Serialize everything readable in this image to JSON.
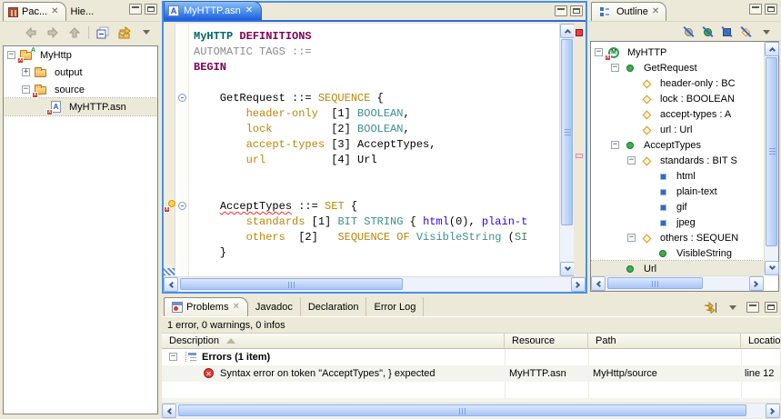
{
  "icons": {
    "close_glyph": "✕",
    "collapse_glyph": "−",
    "expand_glyph": "+",
    "asn_letter": "A",
    "module_letter": "M",
    "badge_letter": "x",
    "project_deco": "A"
  },
  "colors": {
    "chrome_bg": "#ece9d8",
    "active_tab_blue": "#1a5edb",
    "editor_border_blue": "#4791e6",
    "error_red": "#dd3b35",
    "keyword_purple": "#7f0055",
    "module_teal": "#006666",
    "type_teal": "#3a8f8f",
    "field_gold": "#b8860b",
    "string_blue": "#2a00ff",
    "selection_beige": "#ebe9d9"
  },
  "package_explorer": {
    "tab_active": "Pac...",
    "tab_inactive": "Hie...",
    "toolbar_icons": [
      "back-icon",
      "forward-icon",
      "up-icon",
      "collapse-all-icon",
      "link-with-editor-icon",
      "view-menu-icon"
    ],
    "tree": [
      {
        "label": "MyHttp",
        "icon": "project-error",
        "indent": 0,
        "expander": "minus"
      },
      {
        "label": "output",
        "icon": "folder",
        "indent": 1,
        "expander": "plus"
      },
      {
        "label": "source",
        "icon": "folder-error",
        "indent": 1,
        "expander": "minus"
      },
      {
        "label": "MyHTTP.asn",
        "icon": "asn-file-error",
        "indent": 2,
        "expander": "none",
        "selected": true
      }
    ]
  },
  "editor": {
    "tab_label": "MyHTTP.asn",
    "code_lines": [
      [
        {
          "t": "MyHTTP",
          "c": "mod"
        },
        {
          "t": " ",
          "c": "plain"
        },
        {
          "t": "DEFINITIONS",
          "c": "kw"
        }
      ],
      [
        {
          "t": "AUTOMATIC TAGS ::=",
          "c": "gray"
        }
      ],
      [
        {
          "t": "BEGIN",
          "c": "kw"
        }
      ],
      [],
      [
        {
          "t": "    GetRequest ::= ",
          "c": "plain"
        },
        {
          "t": "SEQUENCE",
          "c": "gold"
        },
        {
          "t": " {",
          "c": "plain"
        }
      ],
      [
        {
          "t": "        ",
          "c": "plain"
        },
        {
          "t": "header-only",
          "c": "gold"
        },
        {
          "t": "  [1] ",
          "c": "plain"
        },
        {
          "t": "BOOLEAN",
          "c": "type"
        },
        {
          "t": ",",
          "c": "plain"
        }
      ],
      [
        {
          "t": "        ",
          "c": "plain"
        },
        {
          "t": "lock",
          "c": "gold"
        },
        {
          "t": "         [2] ",
          "c": "plain"
        },
        {
          "t": "BOOLEAN",
          "c": "type"
        },
        {
          "t": ",",
          "c": "plain"
        }
      ],
      [
        {
          "t": "        ",
          "c": "plain"
        },
        {
          "t": "accept-types",
          "c": "gold"
        },
        {
          "t": " [3] AcceptTypes,",
          "c": "plain"
        }
      ],
      [
        {
          "t": "        ",
          "c": "plain"
        },
        {
          "t": "url",
          "c": "gold"
        },
        {
          "t": "          [4] Url",
          "c": "plain"
        }
      ],
      [],
      [],
      [
        {
          "t": "    ",
          "c": "plain"
        },
        {
          "t": "AcceptTypes",
          "c": "err"
        },
        {
          "t": " ::= ",
          "c": "plain"
        },
        {
          "t": "SET",
          "c": "gold"
        },
        {
          "t": " {",
          "c": "plain"
        }
      ],
      [
        {
          "t": "        ",
          "c": "plain"
        },
        {
          "t": "standards",
          "c": "gold"
        },
        {
          "t": " [1] ",
          "c": "plain"
        },
        {
          "t": "BIT STRING",
          "c": "type"
        },
        {
          "t": " { ",
          "c": "plain"
        },
        {
          "t": "html",
          "c": "str"
        },
        {
          "t": "(0), ",
          "c": "plain"
        },
        {
          "t": "plain-t",
          "c": "str"
        }
      ],
      [
        {
          "t": "        ",
          "c": "plain"
        },
        {
          "t": "others",
          "c": "gold"
        },
        {
          "t": "  [2]   ",
          "c": "plain"
        },
        {
          "t": "SEQUENCE OF",
          "c": "gold"
        },
        {
          "t": " ",
          "c": "plain"
        },
        {
          "t": "VisibleString",
          "c": "type"
        },
        {
          "t": " (",
          "c": "plain"
        },
        {
          "t": "SI",
          "c": "grn"
        }
      ],
      [
        {
          "t": "    }",
          "c": "plain"
        }
      ]
    ]
  },
  "outline": {
    "tab_label": "Outline",
    "toolbar_icons": [
      "filter-circle-gray-icon",
      "filter-circle-green-icon",
      "filter-square-blue-icon",
      "filter-diamond-gold-icon",
      "view-menu-icon"
    ],
    "tree": [
      {
        "label": "MyHTTP",
        "icon": "module-error",
        "indent": 0,
        "expander": "minus"
      },
      {
        "label": "GetRequest",
        "icon": "type",
        "indent": 1,
        "expander": "minus"
      },
      {
        "label": "header-only : BC",
        "icon": "field",
        "indent": 2,
        "expander": "none"
      },
      {
        "label": "lock : BOOLEAN",
        "icon": "field",
        "indent": 2,
        "expander": "none"
      },
      {
        "label": "accept-types : A",
        "icon": "field",
        "indent": 2,
        "expander": "none"
      },
      {
        "label": "url : Url",
        "icon": "field",
        "indent": 2,
        "expander": "none"
      },
      {
        "label": "AcceptTypes",
        "icon": "type",
        "indent": 1,
        "expander": "minus"
      },
      {
        "label": "standards : BIT S",
        "icon": "field",
        "indent": 2,
        "expander": "minus"
      },
      {
        "label": "html",
        "icon": "enum",
        "indent": 3,
        "expander": "none"
      },
      {
        "label": "plain-text",
        "icon": "enum",
        "indent": 3,
        "expander": "none"
      },
      {
        "label": "gif",
        "icon": "enum",
        "indent": 3,
        "expander": "none"
      },
      {
        "label": "jpeg",
        "icon": "enum",
        "indent": 3,
        "expander": "none"
      },
      {
        "label": "others : SEQUEN",
        "icon": "field",
        "indent": 2,
        "expander": "minus"
      },
      {
        "label": "VisibleString",
        "icon": "type",
        "indent": 3,
        "expander": "none"
      },
      {
        "label": "Url",
        "icon": "type",
        "indent": 1,
        "expander": "none",
        "selected": true
      }
    ]
  },
  "problems": {
    "tabs": [
      "Problems",
      "Javadoc",
      "Declaration",
      "Error Log"
    ],
    "status": "1 error, 0 warnings, 0 infos",
    "columns": [
      "Description",
      "Resource",
      "Path",
      "Location"
    ],
    "group_label": "Errors (1 item)",
    "error_row": {
      "description": "Syntax error on token \"AcceptTypes\", } expected",
      "resource": "MyHTTP.asn",
      "path": "MyHttp/source",
      "location": "line 12"
    }
  }
}
